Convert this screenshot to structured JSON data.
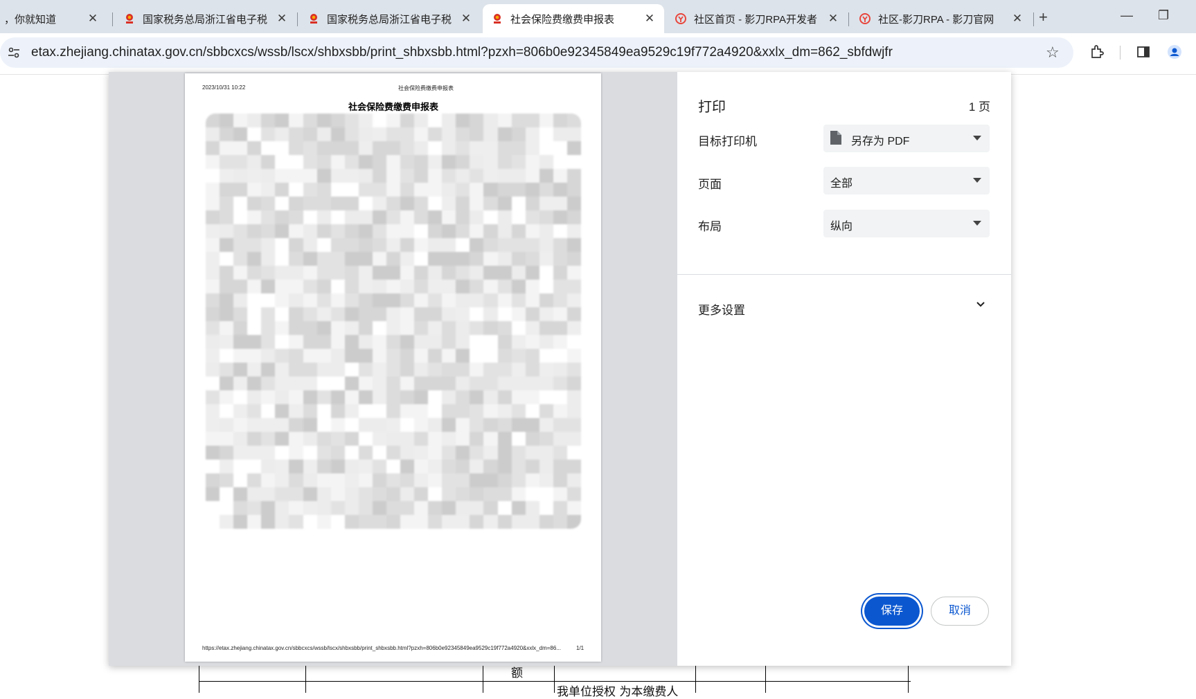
{
  "tabs": [
    {
      "title": "，你就知道",
      "favicon": "none",
      "active": false
    },
    {
      "title": "国家税务总局浙江省电子税",
      "favicon": "tax-emblem-icon",
      "active": false
    },
    {
      "title": "国家税务总局浙江省电子税",
      "favicon": "tax-emblem-icon",
      "active": false
    },
    {
      "title": "社会保险费缴费申报表",
      "favicon": "tax-emblem-icon",
      "active": true
    },
    {
      "title": "社区首页 - 影刀RPA开发者",
      "favicon": "yingdao-icon",
      "active": false
    },
    {
      "title": "社区-影刀RPA - 影刀官网",
      "favicon": "yingdao-icon",
      "active": false
    }
  ],
  "tab_close_glyph": "✕",
  "new_tab_glyph": "+",
  "window": {
    "minimize_glyph": "—",
    "restore_glyph": "❐"
  },
  "address_bar": {
    "url": "etax.zhejiang.chinatax.gov.cn/sbbcxcs/wssb/lscx/shbxsbb/print_shbxsbb.html?pzxh=806b0e92345849ea9529c19f772a4920&xxlx_dm=862_sbfdwjfr",
    "bookmark_glyph": "☆"
  },
  "print_dialog": {
    "title": "打印",
    "page_count": "1 页",
    "destination": {
      "label": "目标打印机",
      "value": "另存为 PDF"
    },
    "pages": {
      "label": "页面",
      "value": "全部"
    },
    "layout": {
      "label": "布局",
      "value": "纵向"
    },
    "more_settings": "更多设置",
    "save_button": "保存",
    "cancel_button": "取消"
  },
  "preview_sheet": {
    "header_date": "2023/10/31 10:22",
    "header_title": "社会保险费缴费申报表",
    "doc_title": "社会保险费缴费申报表",
    "footer_url": "https://etax.zhejiang.chinatax.gov.cn/sbbcxcs/wssb/lscx/shbxsbb/print_shbxsbb.html?pzxh=806b0e92345849ea9529c19f772a4920&xxlx_dm=86...",
    "footer_page": "1/1"
  },
  "page_behind": {
    "cell_text_1": "额",
    "cell_text_2": "我单位授权 为本缴费人"
  },
  "colors": {
    "tabstrip": "#dde3ea",
    "omnibox": "#edf2fa",
    "primary_button": "#0b57d0",
    "preview_bg": "#dadce0"
  }
}
